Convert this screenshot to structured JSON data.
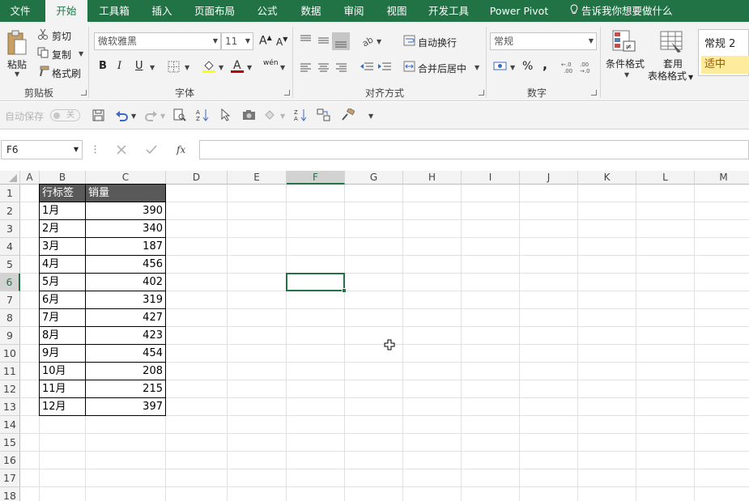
{
  "tabs": [
    "文件",
    "开始",
    "工具箱",
    "插入",
    "页面布局",
    "公式",
    "数据",
    "审阅",
    "视图",
    "开发工具",
    "Power Pivot"
  ],
  "tell_me": "告诉我你想要做什么",
  "ribbon": {
    "clipboard": {
      "paste": "粘贴",
      "cut": "剪切",
      "copy": "复制",
      "format_painter": "格式刷",
      "label": "剪贴板"
    },
    "font": {
      "name": "微软雅黑",
      "size": "11",
      "bold": "B",
      "italic": "I",
      "underline": "U",
      "grow": "A",
      "shrink": "A",
      "label": "字体",
      "wen": "wén"
    },
    "alignment": {
      "wrap": "自动换行",
      "merge": "合并后居中",
      "label": "对齐方式"
    },
    "number": {
      "format": "常规",
      "percent": "%",
      "comma": ",",
      "label": "数字"
    },
    "styles": {
      "cond": "条件格式",
      "table_line1": "套用",
      "table_line2": "表格格式",
      "style1": "常规 2",
      "style2": "适中"
    }
  },
  "qat": {
    "autosave": "自动保存",
    "autosave_state": "关"
  },
  "formula_bar": {
    "name_box": "F6",
    "fx": "fx",
    "value": ""
  },
  "columns": [
    "A",
    "B",
    "C",
    "D",
    "E",
    "F",
    "G",
    "H",
    "I",
    "J",
    "K",
    "L",
    "M"
  ],
  "rows": [
    "1",
    "2",
    "3",
    "4",
    "5",
    "6",
    "7",
    "8",
    "9",
    "10",
    "11",
    "12",
    "13",
    "14",
    "15",
    "16",
    "17",
    "18"
  ],
  "table": {
    "headers": [
      "行标签",
      "销量"
    ],
    "rows": [
      [
        "1月",
        "390"
      ],
      [
        "2月",
        "340"
      ],
      [
        "3月",
        "187"
      ],
      [
        "4月",
        "456"
      ],
      [
        "5月",
        "402"
      ],
      [
        "6月",
        "319"
      ],
      [
        "7月",
        "427"
      ],
      [
        "8月",
        "423"
      ],
      [
        "9月",
        "454"
      ],
      [
        "10月",
        "208"
      ],
      [
        "11月",
        "215"
      ],
      [
        "12月",
        "397"
      ]
    ]
  },
  "selected_cell": "F6",
  "colors": {
    "accent": "#217346",
    "header_fill": "#595959",
    "style_mid": "#ffeb9c"
  }
}
